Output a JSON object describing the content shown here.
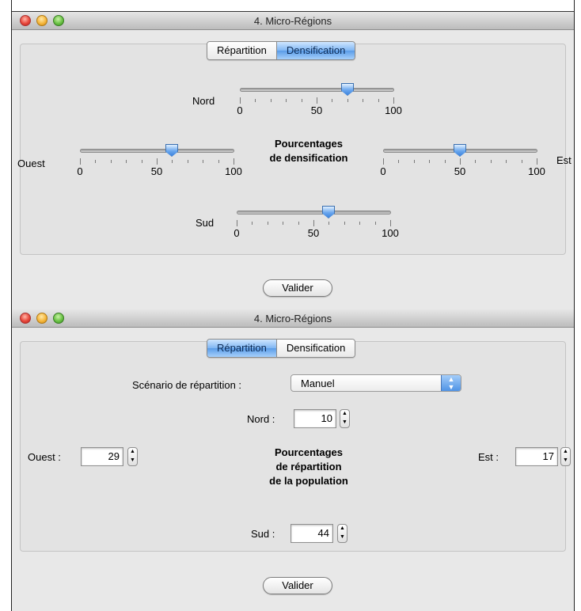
{
  "window1": {
    "title": "4. Micro-Régions",
    "tabs": [
      {
        "label": "Répartition",
        "selected": false
      },
      {
        "label": "Densification",
        "selected": true
      }
    ],
    "center_title": [
      "Pourcentages",
      "de densification"
    ],
    "sliders": {
      "nord": {
        "label": "Nord",
        "value": 70,
        "min": "0",
        "mid": "50",
        "max": "100"
      },
      "ouest": {
        "label": "Ouest",
        "value": 60,
        "min": "0",
        "mid": "50",
        "max": "100"
      },
      "est": {
        "label": "Est",
        "value": 50,
        "min": "0",
        "mid": "50",
        "max": "100"
      },
      "sud": {
        "label": "Sud",
        "value": 60,
        "min": "0",
        "mid": "50",
        "max": "100"
      }
    },
    "validate_label": "Valider"
  },
  "window2": {
    "title": "4. Micro-Régions",
    "tabs": [
      {
        "label": "Répartition",
        "selected": true
      },
      {
        "label": "Densification",
        "selected": false
      }
    ],
    "scenario_label": "Scénario de répartition :",
    "scenario_value": "Manuel",
    "center_title": [
      "Pourcentages",
      "de répartition",
      "de la population"
    ],
    "fields": {
      "nord": {
        "label": "Nord :",
        "value": "10"
      },
      "ouest": {
        "label": "Ouest :",
        "value": "29"
      },
      "est": {
        "label": "Est :",
        "value": "17"
      },
      "sud": {
        "label": "Sud :",
        "value": "44"
      }
    },
    "validate_label": "Valider"
  },
  "colors": {
    "accent": "#5a9ce8",
    "window_bg": "#e8e8e8",
    "close": "#e8473b",
    "minimize": "#f5b63b",
    "zoom": "#6ac245"
  },
  "icons": [
    "close-traffic-light",
    "minimize-traffic-light",
    "zoom-traffic-light",
    "slider-knob",
    "popup-arrows",
    "stepper-arrows"
  ]
}
